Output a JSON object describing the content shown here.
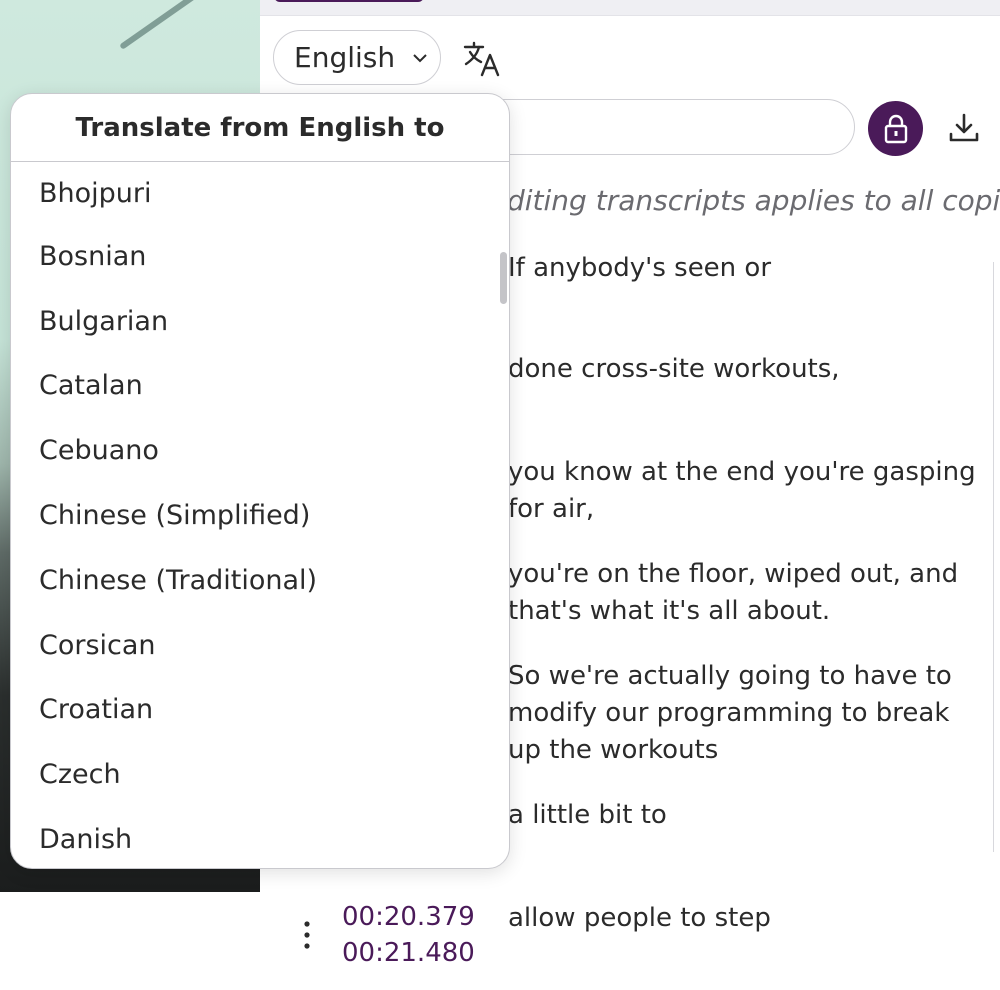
{
  "language_select": {
    "value": "English"
  },
  "translate_menu": {
    "header": "Translate from English to",
    "items": [
      "Bhojpuri",
      "Bosnian",
      "Bulgarian",
      "Catalan",
      "Cebuano",
      "Chinese (Simplified)",
      "Chinese (Traditional)",
      "Corsican",
      "Croatian",
      "Czech",
      "Danish"
    ]
  },
  "note": "diting transcripts applies to all copies",
  "transcript": {
    "lines": [
      "If anybody's seen or",
      "done cross-site workouts,",
      "you know at the end you're gasping for air,",
      "you're on the floor, wiped out, and that's what it's all about.",
      "So we're actually going to have to modify our programming to break up the workouts",
      "a little bit to"
    ],
    "bottom_cue": {
      "start": "00:20.379",
      "end": "00:21.480",
      "text": "allow people to step"
    }
  },
  "icons": {
    "chevron": "chevron-down-icon",
    "translate": "translate-icon",
    "lock": "lock-icon",
    "download": "download-icon",
    "more": "more-vertical-icon"
  },
  "colors": {
    "accent": "#4a1a59"
  }
}
